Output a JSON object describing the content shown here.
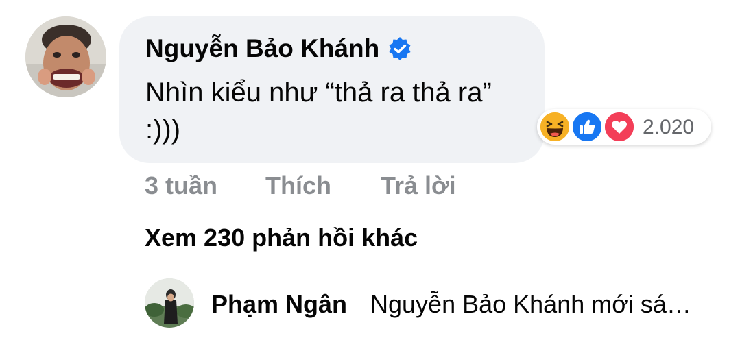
{
  "comment": {
    "author": "Nguyễn Bảo Khánh",
    "text": "Nhìn kiểu như “thả ra thả ra” :)))",
    "verified_icon": "verified-badge-icon",
    "reactions": {
      "icons": [
        "haha-icon",
        "like-icon",
        "love-icon"
      ],
      "count": "2.020"
    },
    "actions": {
      "time": "3 tuần",
      "like_label": "Thích",
      "reply_label": "Trả lời"
    }
  },
  "view_more_replies": "Xem 230 phản hồi khác",
  "reply_preview": {
    "author": "Phạm Ngân",
    "text": "Nguyễn Bảo Khánh mới sá…"
  },
  "colors": {
    "bubble_bg": "#f0f2f5",
    "verified": "#1877f2",
    "like": "#1877f2",
    "love": "#f33e58",
    "haha": "#f7b125",
    "secondary_text": "#8a8d91"
  }
}
